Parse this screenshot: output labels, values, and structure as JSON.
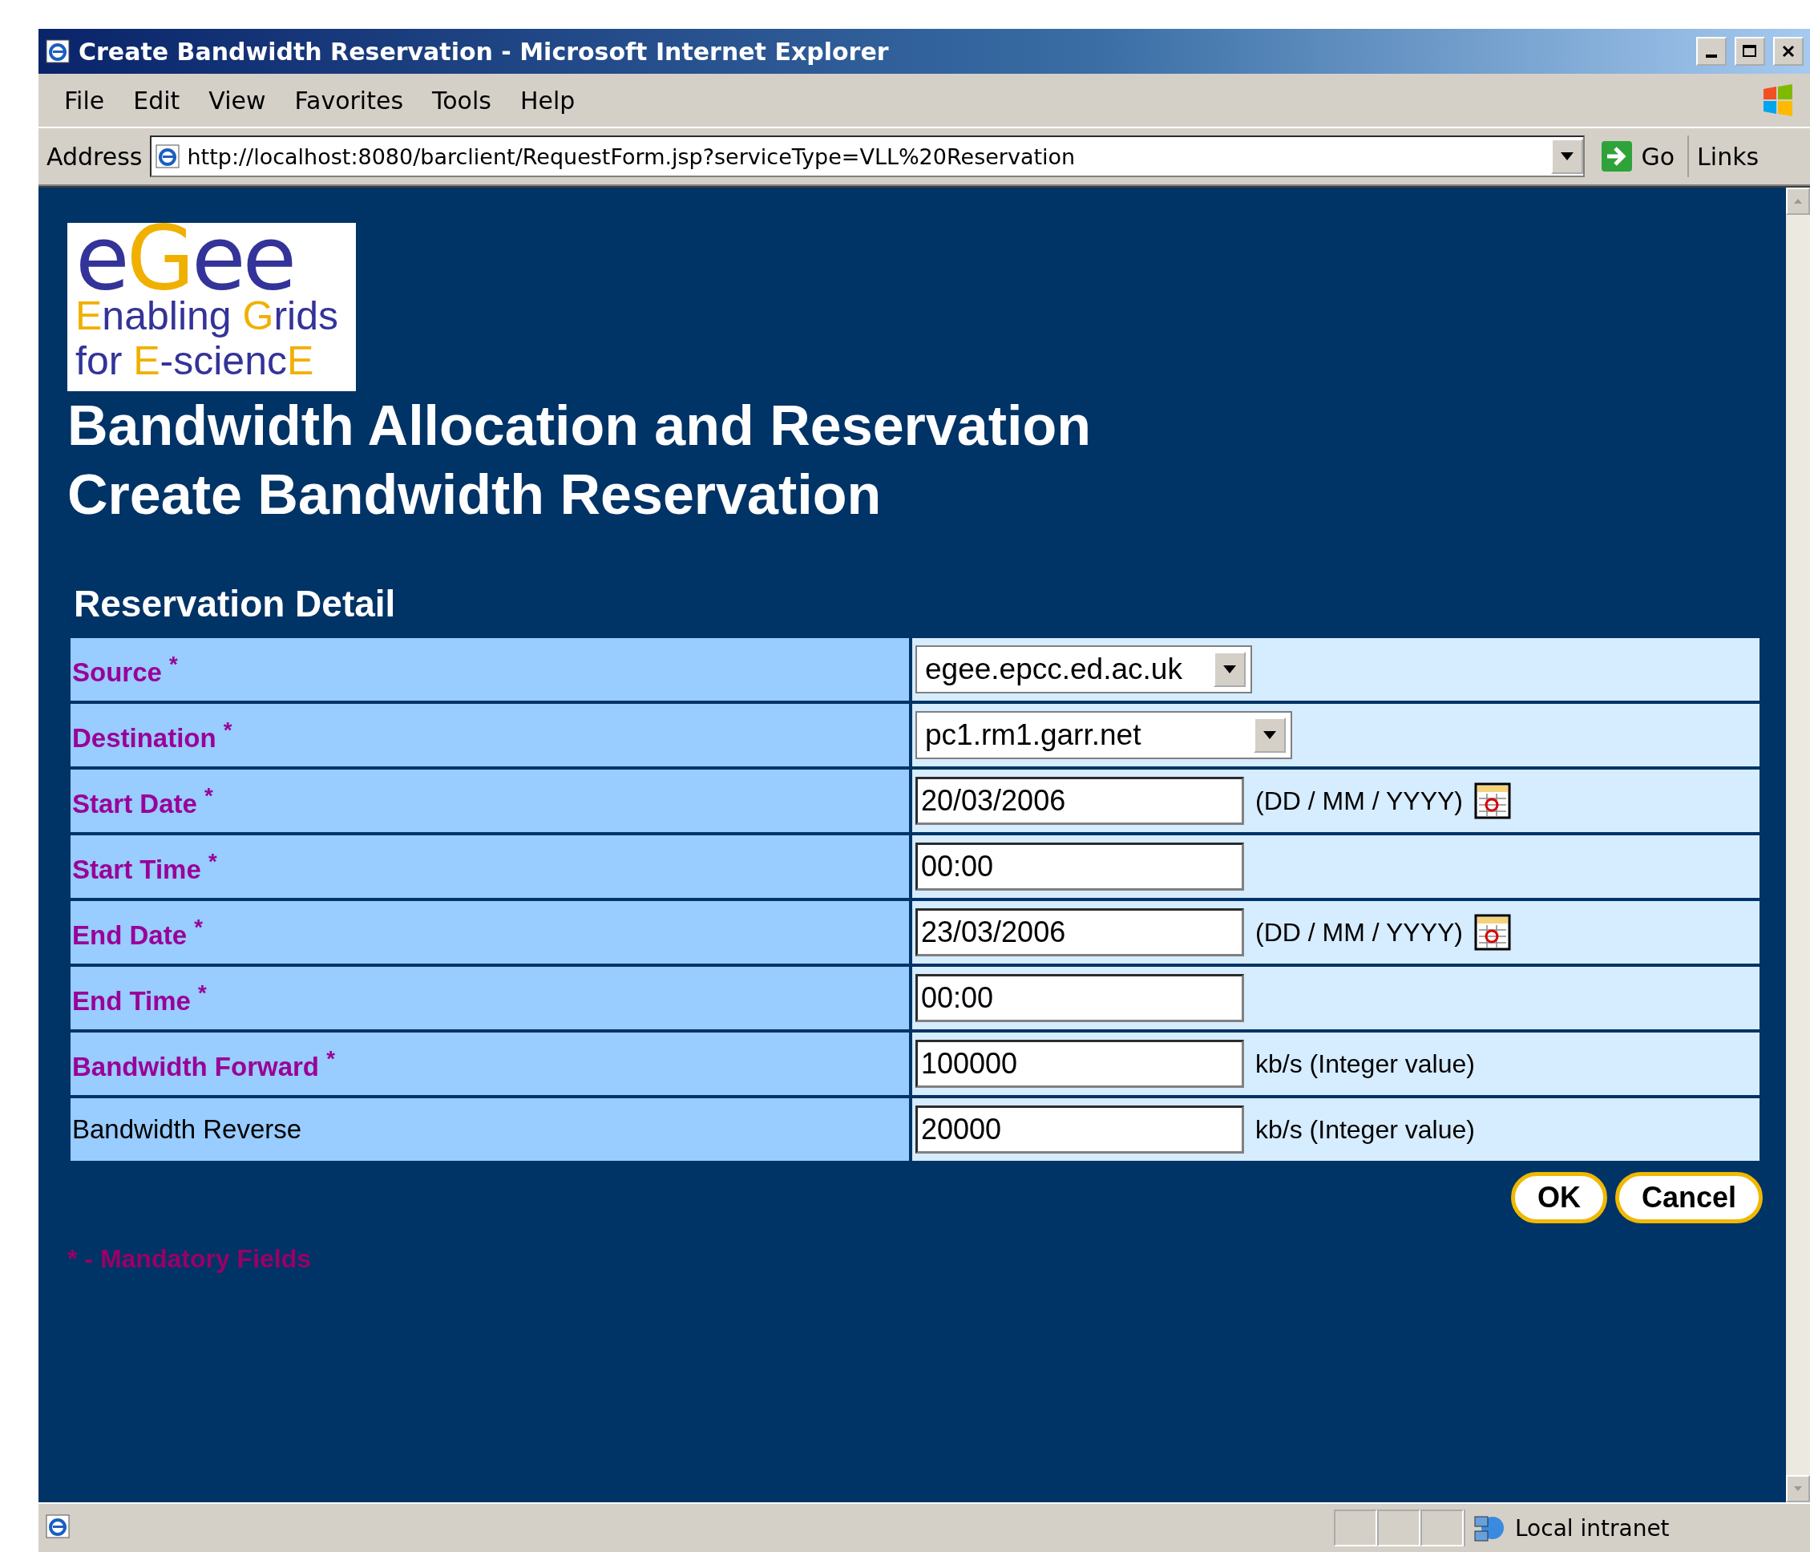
{
  "window": {
    "title": "Create Bandwidth Reservation - Microsoft Internet Explorer"
  },
  "menu": [
    "File",
    "Edit",
    "View",
    "Favorites",
    "Tools",
    "Help"
  ],
  "address_bar": {
    "label": "Address",
    "url": "http://localhost:8080/barclient/RequestForm.jsp?serviceType=VLL%20Reservation",
    "go": "Go",
    "links": "Links"
  },
  "logo": {
    "wordmark": [
      {
        "text": "e",
        "accent": false
      },
      {
        "text": "G",
        "accent": true
      },
      {
        "text": "ee",
        "accent": false
      }
    ],
    "tagline": [
      [
        {
          "text": "E",
          "accent": true
        },
        {
          "text": "nabling ",
          "accent": false
        },
        {
          "text": "G",
          "accent": true
        },
        {
          "text": "rids",
          "accent": false
        }
      ],
      [
        {
          "text": "for ",
          "accent": false
        },
        {
          "text": "E",
          "accent": true
        },
        {
          "text": "-scienc",
          "accent": false
        },
        {
          "text": "E",
          "accent": true
        }
      ]
    ]
  },
  "headings": [
    "Bandwidth Allocation and Reservation",
    "Create Bandwidth Reservation"
  ],
  "section_title": "Reservation Detail",
  "rows": [
    {
      "label": "Source $^{*}$",
      "required": true,
      "kind": "select",
      "value": "egee.epcc.ed.ac.uk",
      "wide": false
    },
    {
      "label": "Destination $^{*}$",
      "required": true,
      "kind": "select",
      "value": "pc1.rm1.garr.net",
      "wide": true
    },
    {
      "label": "Start Date $^{*}$",
      "required": true,
      "kind": "date",
      "value": "20/03/2006",
      "hint": "(DD / MM / YYYY)"
    },
    {
      "label": "Start Time $^{*}$",
      "required": true,
      "kind": "text",
      "value": "00:00"
    },
    {
      "label": "End Date $^{*}$",
      "required": true,
      "kind": "date",
      "value": "23/03/2006",
      "hint": "(DD / MM / YYYY)"
    },
    {
      "label": "End Time $^{*}$",
      "required": true,
      "kind": "text",
      "value": "00:00"
    },
    {
      "label": "Bandwidth Forward $^{*}$",
      "required": true,
      "kind": "text",
      "value": "100000",
      "hint": "kb/s (Integer value)"
    },
    {
      "label": "Bandwidth Reverse",
      "required": false,
      "kind": "text",
      "value": "20000",
      "hint": "kb/s (Integer value)"
    }
  ],
  "buttons": [
    "OK",
    "Cancel"
  ],
  "mandatory_note": "* - Mandatory Fields",
  "status_bar": {
    "zone": "Local intranet"
  }
}
